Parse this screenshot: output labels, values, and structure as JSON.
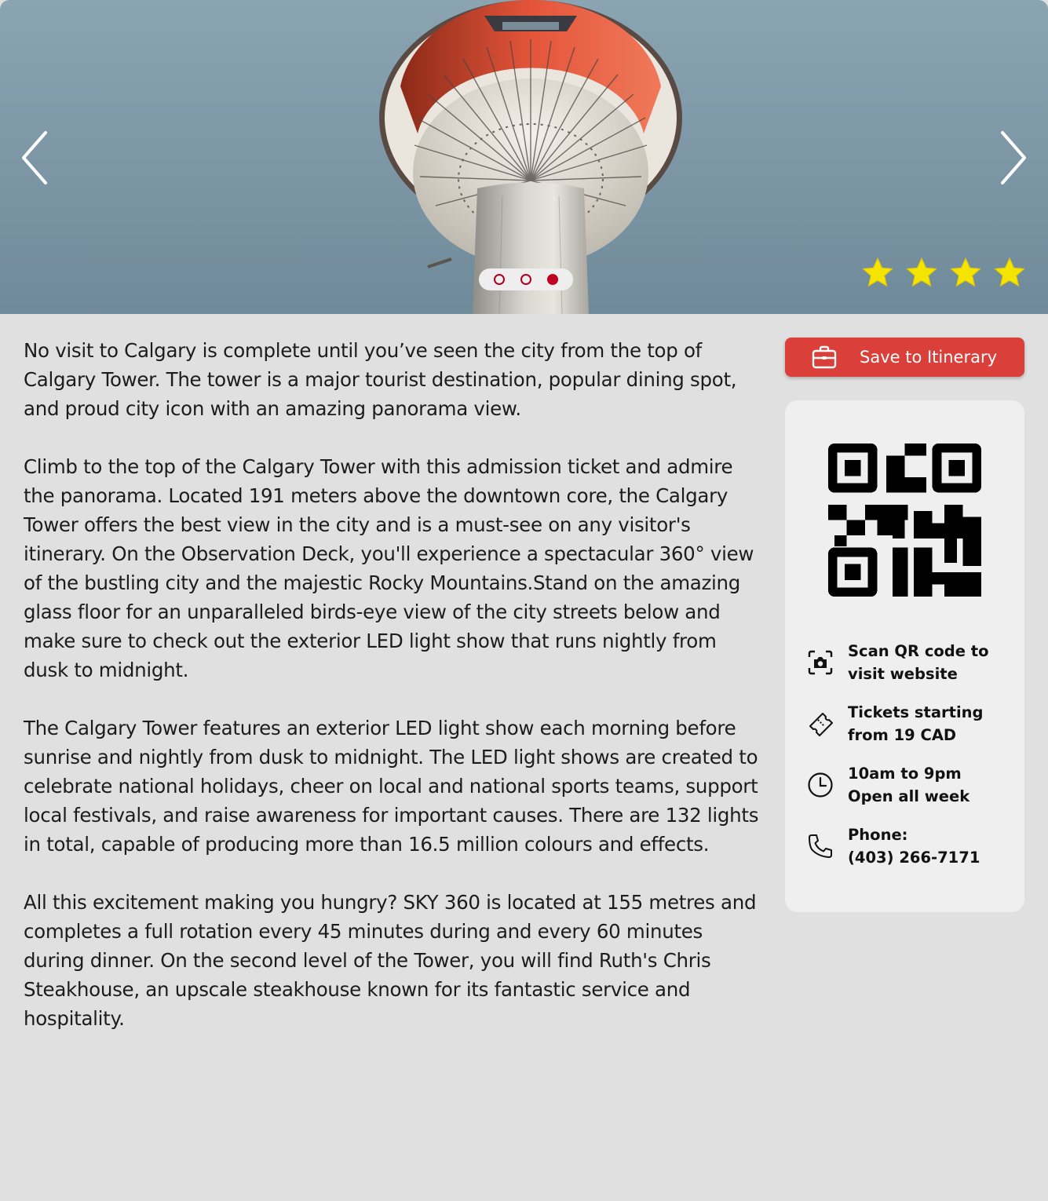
{
  "hero": {
    "prev_label": "previous image",
    "next_label": "next image",
    "slide_count": 3,
    "active_slide": 3,
    "rating": 4,
    "rating_color": "#f5e300"
  },
  "description": [
    "No visit to Calgary is complete until you’ve seen the city from the top of Calgary Tower. The tower is a major tourist destination, popular dining spot, and proud city icon with an amazing panorama view.",
    "Climb to the top of the Calgary Tower with this admission ticket and admire the panorama. Located 191 meters above the downtown core, the Calgary Tower offers the best view in the city and is a must-see on any visitor's itinerary. On the Observation Deck, you'll experience a spectacular 360° view of the bustling city and the majestic Rocky Mountains.Stand on the amazing glass floor for an unparalleled birds-eye view of the city streets below and make sure to check out the exterior LED light show that runs nightly from dusk to midnight.",
    "The Calgary Tower features an exterior LED light show each morning before sunrise and nightly from dusk to midnight. The LED light shows are created to celebrate national holidays, cheer on local and national sports teams, support local festivals, and raise awareness for important causes. There are 132 lights in total, capable of producing more than 16.5 million colours and effects.",
    "All this excitement making you hungry? SKY 360 is located at 155 metres and completes a full rotation every 45 minutes during and every 60 minutes during dinner. On the second level of the Tower, you will find Ruth's Chris Steakhouse, an upscale steakhouse known for its fantastic service and hospitality."
  ],
  "sidebar": {
    "save_button": {
      "label": "Save to Itinerary",
      "icon": "briefcase-icon",
      "color": "#db3f3a"
    },
    "info": [
      {
        "icon": "camera-scan-icon",
        "line1": "Scan QR code to",
        "line2": "visit website"
      },
      {
        "icon": "ticket-icon",
        "line1": "Tickets starting",
        "line2": "from 19 CAD"
      },
      {
        "icon": "clock-icon",
        "line1": "10am to 9pm",
        "line2": "Open all week"
      },
      {
        "icon": "phone-icon",
        "line1": "Phone:",
        "line2": "(403) 266-7171"
      }
    ]
  }
}
